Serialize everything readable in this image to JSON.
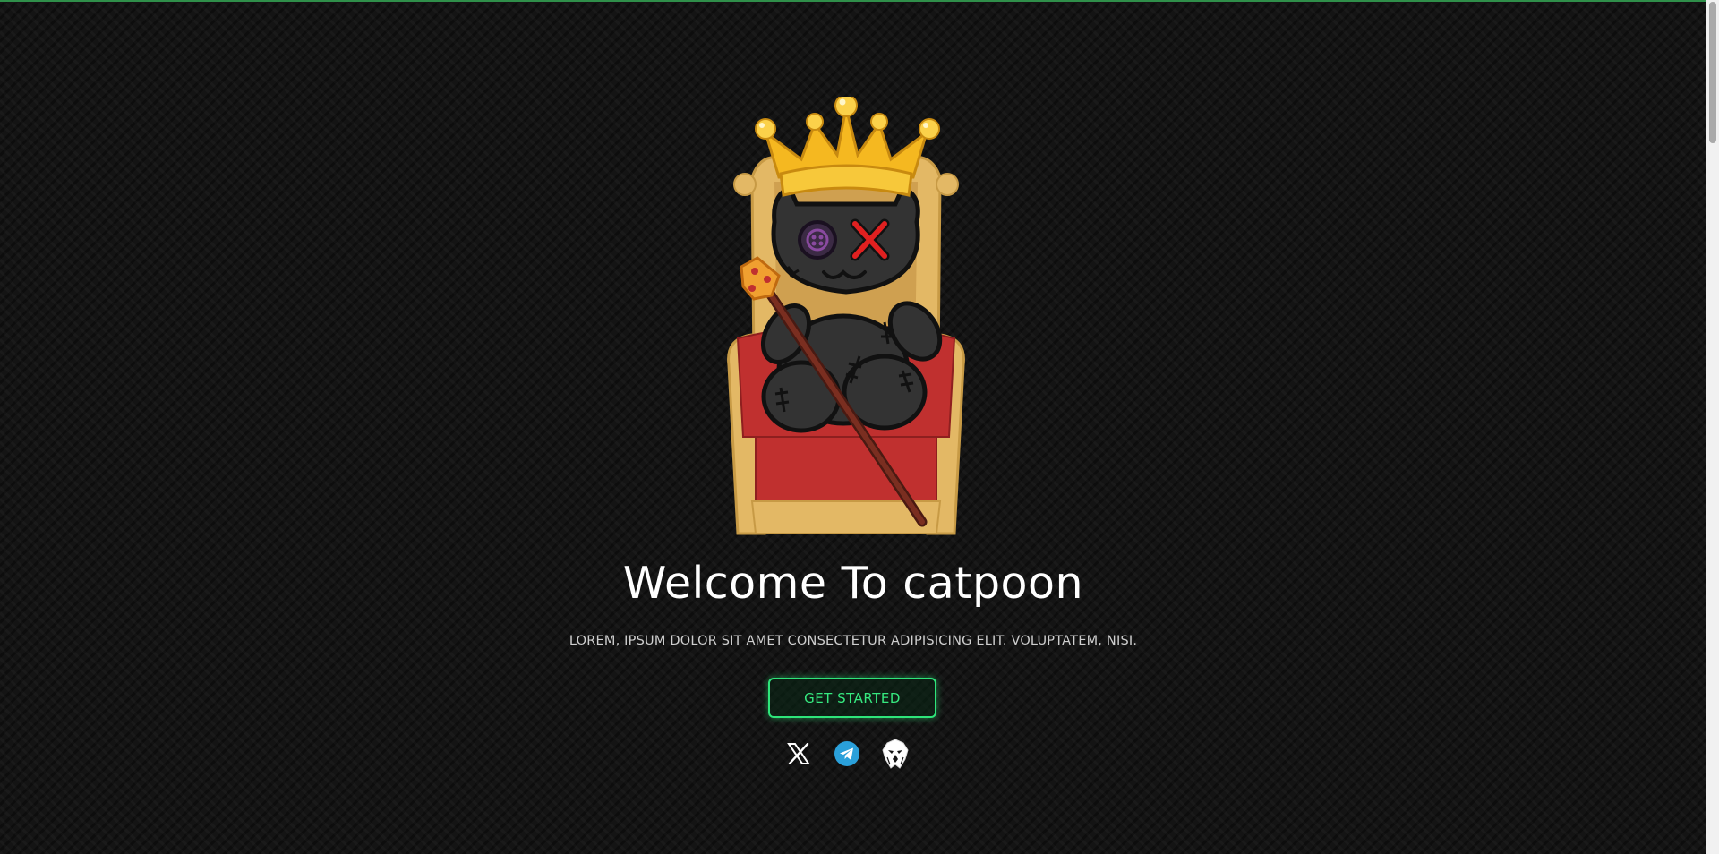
{
  "hero": {
    "title": "Welcome To catpoon",
    "subtitle": "LOREM, IPSUM DOLOR SIT AMET CONSECTETUR ADIPISICING ELIT. VOLUPTATEM, NISI.",
    "cta_label": "GET STARTED"
  },
  "mascot": {
    "icon": "voodoo-cat-king-on-throne"
  },
  "socials": [
    {
      "icon": "x-twitter-icon"
    },
    {
      "icon": "telegram-icon"
    },
    {
      "icon": "eagle-icon"
    }
  ],
  "colors": {
    "accent": "#2ee57a",
    "background": "#141414",
    "top_line": "#2f8f4a"
  }
}
